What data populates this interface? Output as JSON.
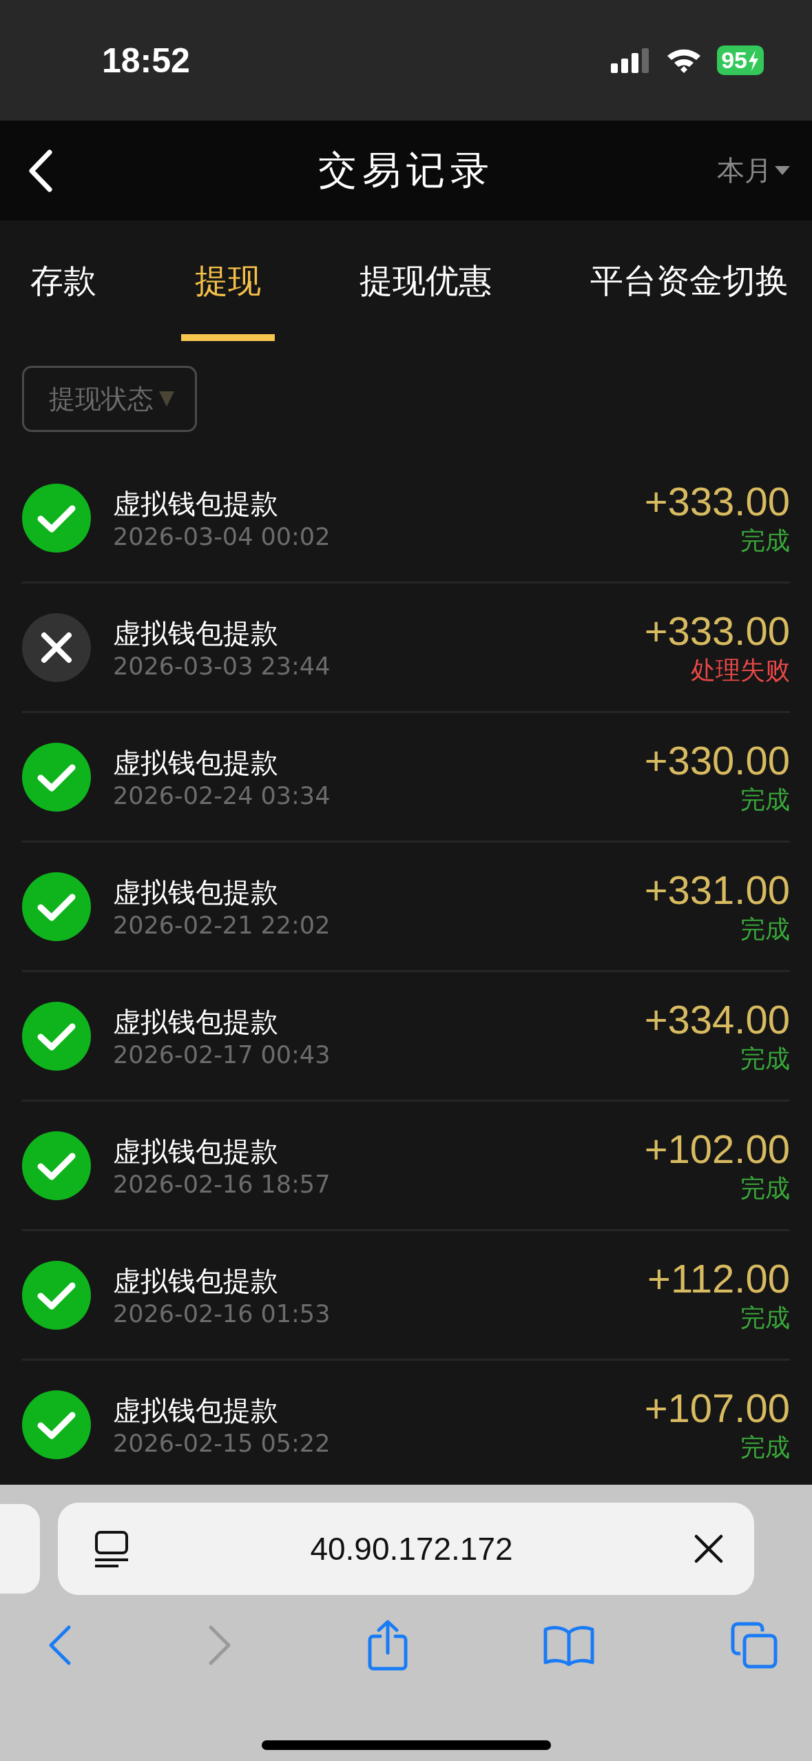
{
  "status_bar": {
    "time": "18:52",
    "battery": "95"
  },
  "header": {
    "title": "交易记录",
    "period": "本月"
  },
  "tabs": [
    {
      "label": "存款",
      "selected": false
    },
    {
      "label": "提现",
      "selected": true
    },
    {
      "label": "提现优惠",
      "selected": false
    },
    {
      "label": "平台资金切换",
      "selected": false
    }
  ],
  "filter": {
    "label": "提现状态"
  },
  "records": [
    {
      "title": "虚拟钱包提款",
      "time": "2026-03-04 00:02",
      "amount": "+333.00",
      "status": "完成",
      "kind": "success"
    },
    {
      "title": "虚拟钱包提款",
      "time": "2026-03-03 23:44",
      "amount": "+333.00",
      "status": "处理失败",
      "kind": "failed"
    },
    {
      "title": "虚拟钱包提款",
      "time": "2026-02-24 03:34",
      "amount": "+330.00",
      "status": "完成",
      "kind": "success"
    },
    {
      "title": "虚拟钱包提款",
      "time": "2026-02-21 22:02",
      "amount": "+331.00",
      "status": "完成",
      "kind": "success"
    },
    {
      "title": "虚拟钱包提款",
      "time": "2026-02-17 00:43",
      "amount": "+334.00",
      "status": "完成",
      "kind": "success"
    },
    {
      "title": "虚拟钱包提款",
      "time": "2026-02-16 18:57",
      "amount": "+102.00",
      "status": "完成",
      "kind": "success"
    },
    {
      "title": "虚拟钱包提款",
      "time": "2026-02-16 01:53",
      "amount": "+112.00",
      "status": "完成",
      "kind": "success"
    },
    {
      "title": "虚拟钱包提款",
      "time": "2026-02-15 05:22",
      "amount": "+107.00",
      "status": "完成",
      "kind": "success"
    }
  ],
  "browser": {
    "url": "40.90.172.172"
  }
}
